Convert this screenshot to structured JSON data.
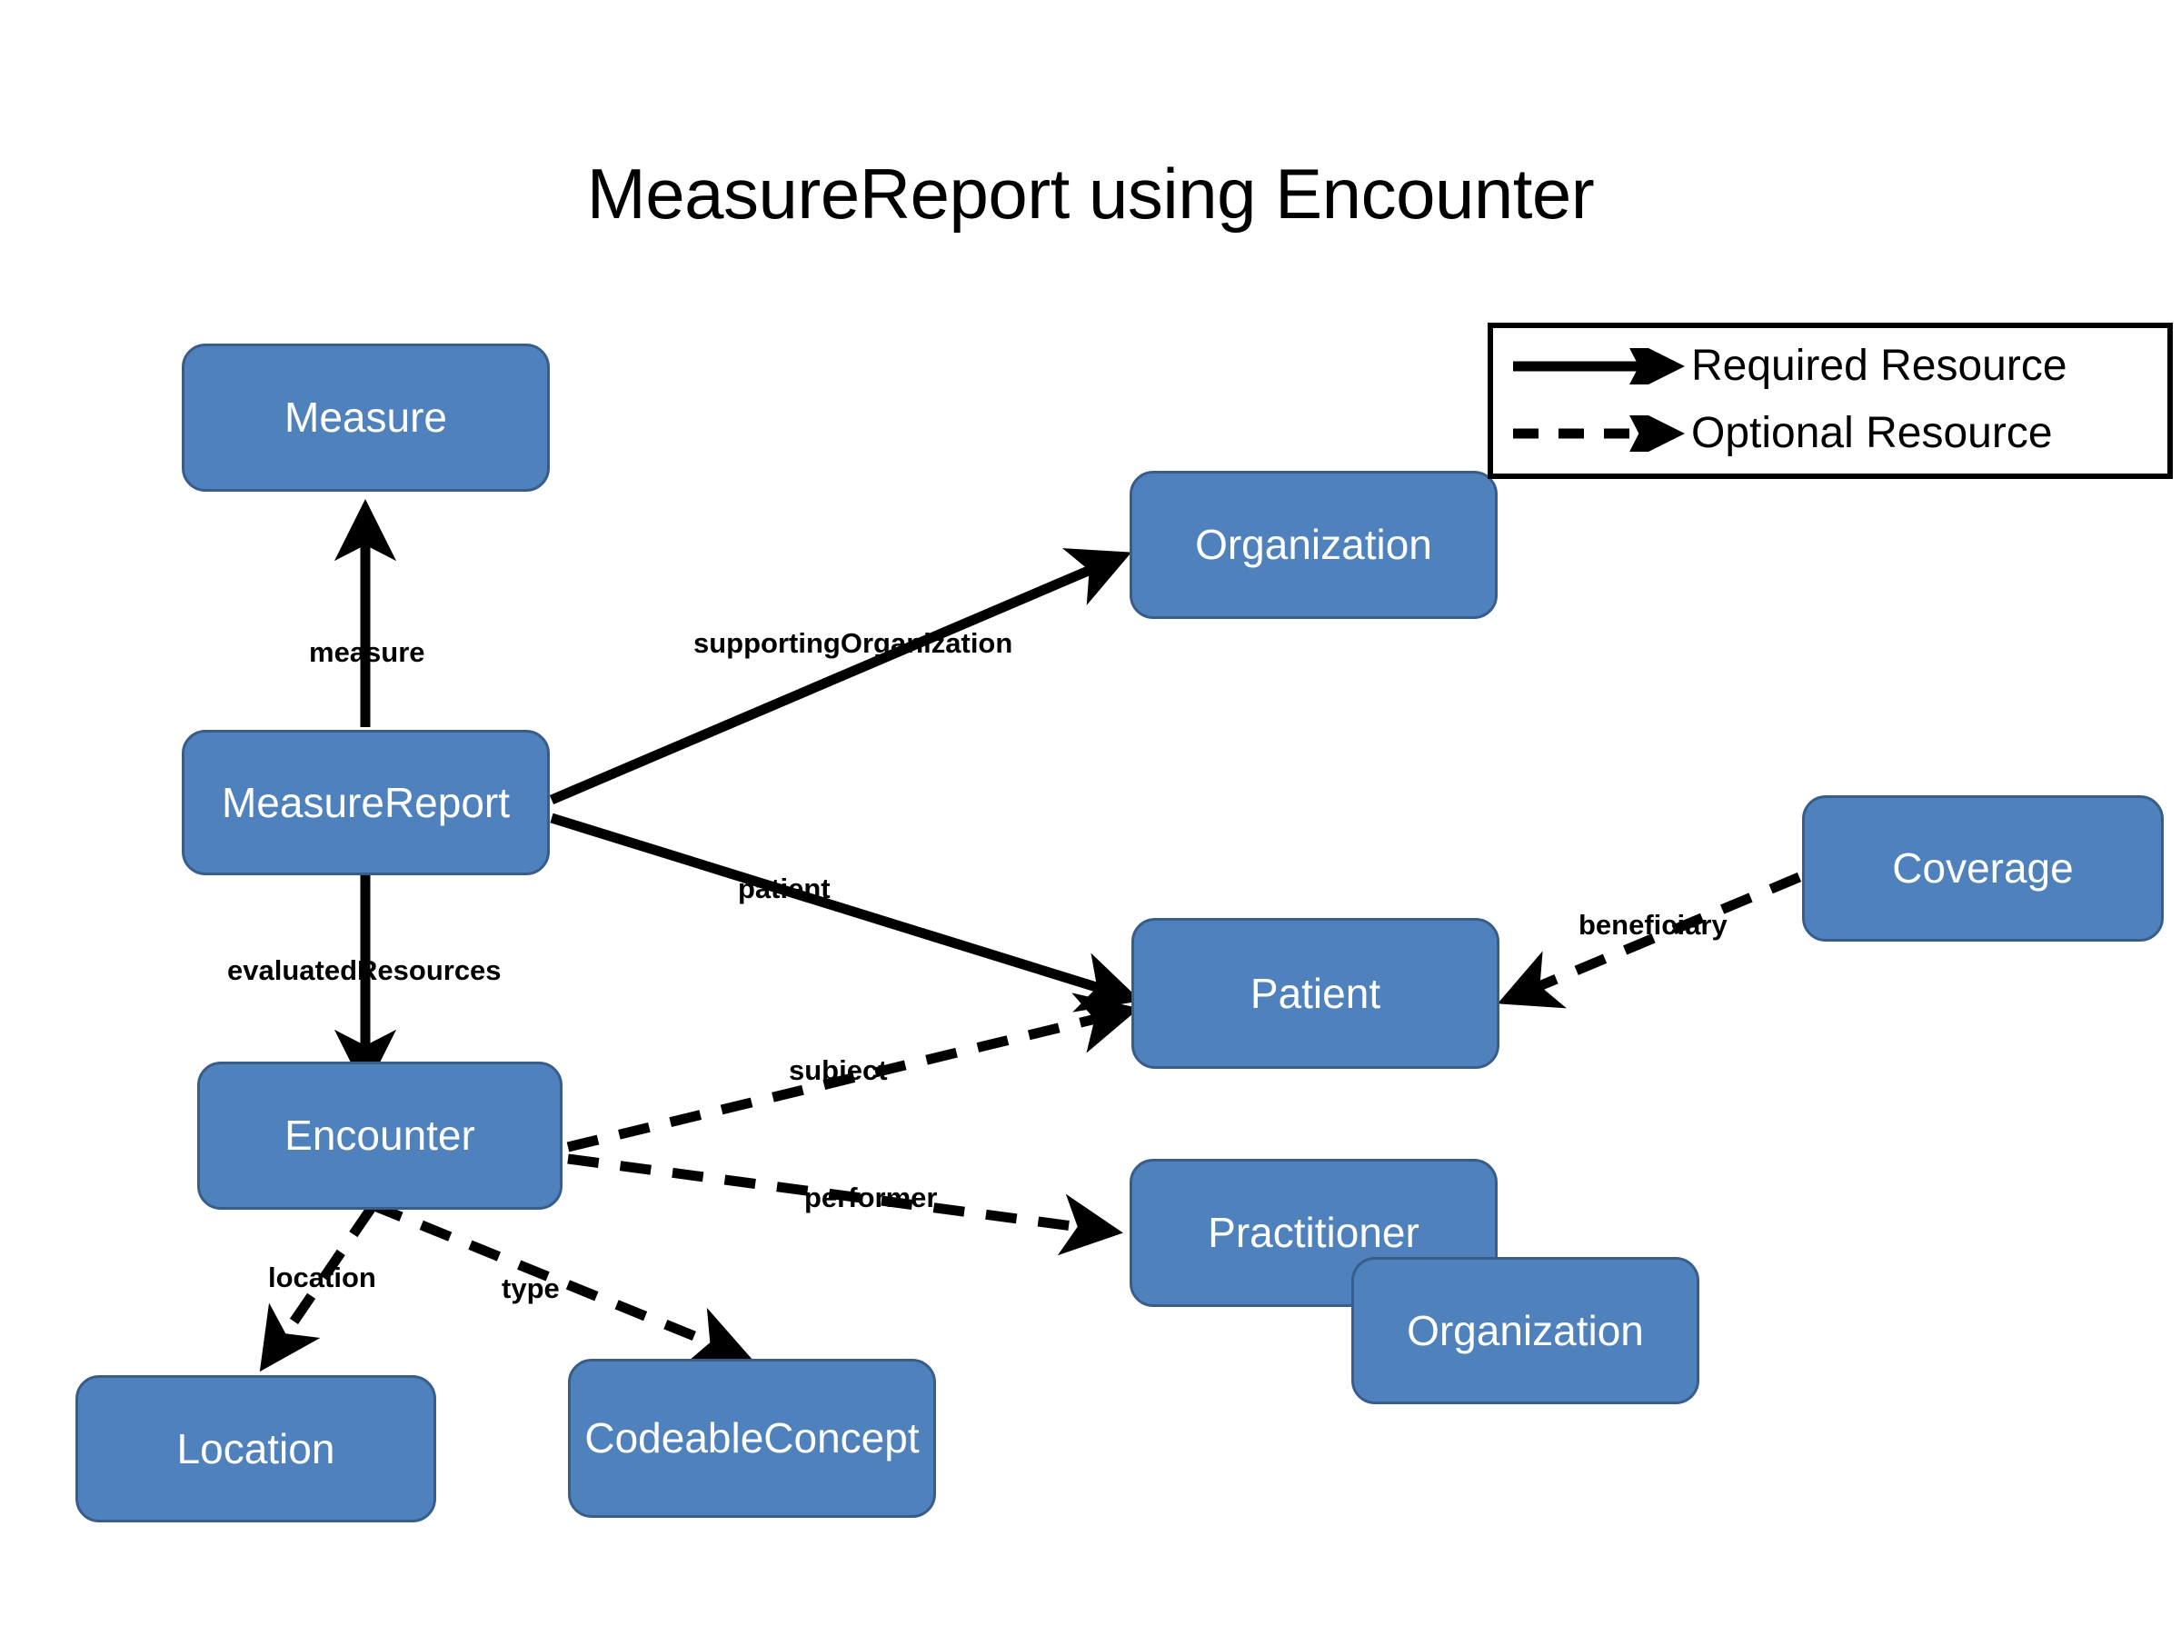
{
  "title": "MeasureReport using Encounter",
  "colors": {
    "node_fill": "#4F81BD",
    "node_border": "#385D8A",
    "node_text": "#FFFFFF",
    "edge": "#000000",
    "background": "#FFFFFF"
  },
  "legend": {
    "items": [
      {
        "label": "Required Resource",
        "style": "solid",
        "icon": "solid-arrow-icon"
      },
      {
        "label": "Optional Resource",
        "style": "dashed",
        "icon": "dashed-arrow-icon"
      }
    ]
  },
  "nodes": [
    {
      "id": "measure",
      "label": "Measure"
    },
    {
      "id": "measurereport",
      "label": "MeasureReport"
    },
    {
      "id": "encounter",
      "label": "Encounter"
    },
    {
      "id": "location",
      "label": "Location"
    },
    {
      "id": "codeableconcept",
      "label": "CodeableConcept"
    },
    {
      "id": "organization",
      "label": "Organization"
    },
    {
      "id": "patient",
      "label": "Patient"
    },
    {
      "id": "coverage",
      "label": "Coverage"
    },
    {
      "id": "practitioner",
      "label": "Practitioner"
    },
    {
      "id": "organization2",
      "label": "Organization"
    }
  ],
  "edges": [
    {
      "id": "measure",
      "label": "measure",
      "from": "measurereport",
      "to": "measure",
      "style": "solid"
    },
    {
      "id": "evaluatedResources",
      "label": "evaluatedResources",
      "from": "measurereport",
      "to": "encounter",
      "style": "solid"
    },
    {
      "id": "supportingOrganization",
      "label": "supportingOrganization",
      "from": "measurereport",
      "to": "organization",
      "style": "solid"
    },
    {
      "id": "patient",
      "label": "patient",
      "from": "measurereport",
      "to": "patient",
      "style": "solid"
    },
    {
      "id": "subject",
      "label": "subject",
      "from": "encounter",
      "to": "patient",
      "style": "dashed"
    },
    {
      "id": "performer",
      "label": "performer",
      "from": "encounter",
      "to": "practitioner",
      "style": "dashed"
    },
    {
      "id": "location",
      "label": "location",
      "from": "encounter",
      "to": "location",
      "style": "dashed"
    },
    {
      "id": "type",
      "label": "type",
      "from": "encounter",
      "to": "codeableconcept",
      "style": "dashed"
    },
    {
      "id": "beneficiary",
      "label": "beneficiary",
      "from": "coverage",
      "to": "patient",
      "style": "dashed"
    }
  ]
}
